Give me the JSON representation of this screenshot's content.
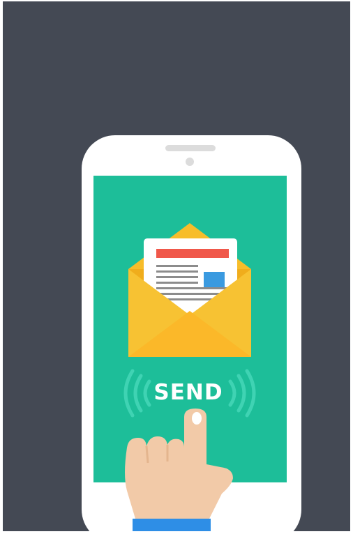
{
  "illustration": {
    "button_label": "SEND",
    "icons": [
      "smartphone-icon",
      "open-envelope-icon",
      "letter-icon",
      "sound-waves-icon",
      "pointing-hand-icon"
    ]
  },
  "colors": {
    "background": "#444954",
    "phone_body": "#ffffff",
    "screen": "#1dbe99",
    "envelope": "#f7bd2a",
    "envelope_front": "#fbc02d",
    "letter": "#ffffff",
    "letter_header": "#f0584a",
    "letter_image": "#3a9ae0",
    "letter_lines": "#8c8c8c",
    "waves": "#3fd3b3",
    "hand_skin": "#f2caa8",
    "sleeve": "#2e8ee6"
  }
}
